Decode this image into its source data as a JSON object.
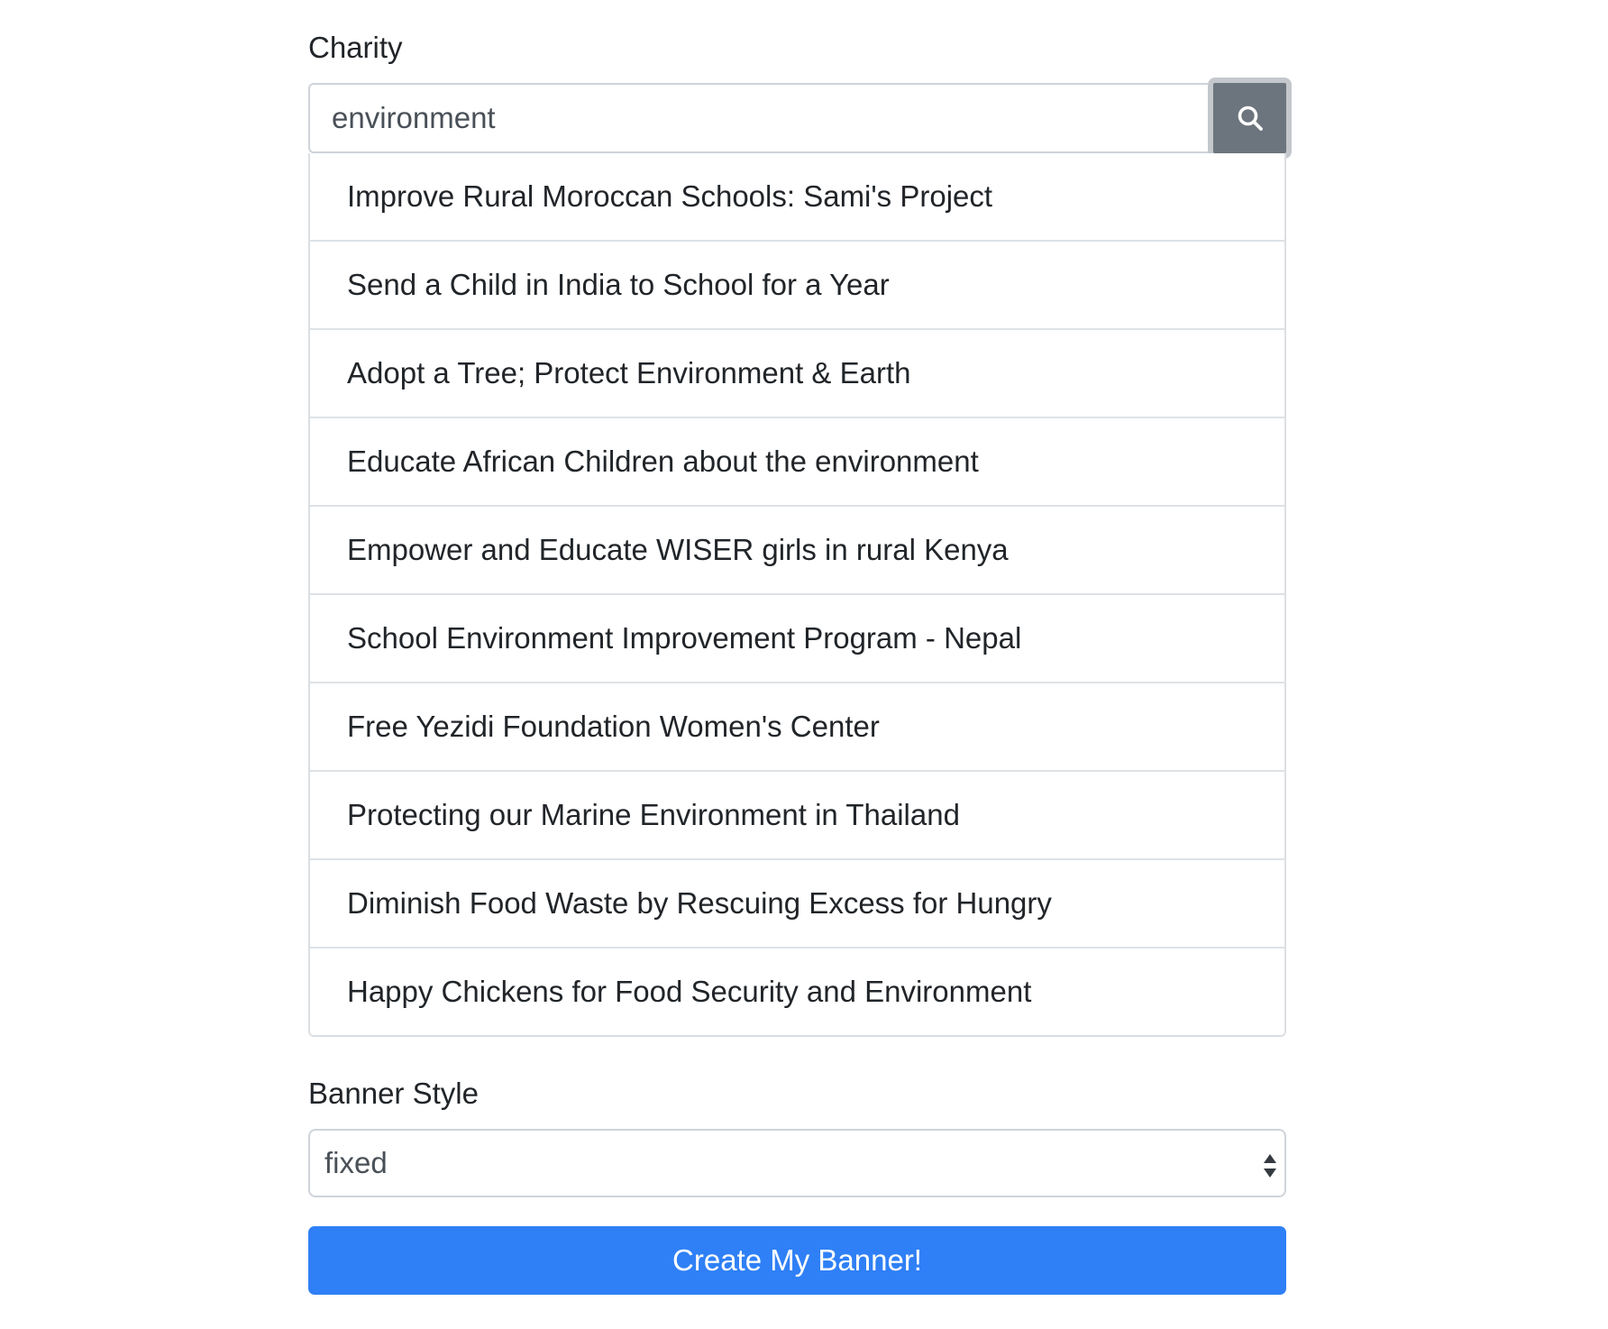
{
  "charity": {
    "label": "Charity",
    "search_value": "environment",
    "search_icon": "search-icon",
    "results": [
      "Improve Rural Moroccan Schools: Sami's Project",
      "Send a Child in India to School for a Year",
      "Adopt a Tree; Protect Environment & Earth",
      "Educate African Children about the environment",
      "Empower and Educate WISER girls in rural Kenya",
      "School Environment Improvement Program - Nepal",
      "Free Yezidi Foundation Women's Center",
      "Protecting our Marine Environment in Thailand",
      "Diminish Food Waste by Rescuing Excess for Hungry",
      "Happy Chickens for Food Security and Environment"
    ]
  },
  "banner_style": {
    "label": "Banner Style",
    "selected": "fixed"
  },
  "submit": {
    "label": "Create My Banner!"
  },
  "colors": {
    "primary": "#2f80f6",
    "search_button": "#6c757d",
    "text": "#212529",
    "border": "#ced4da"
  }
}
